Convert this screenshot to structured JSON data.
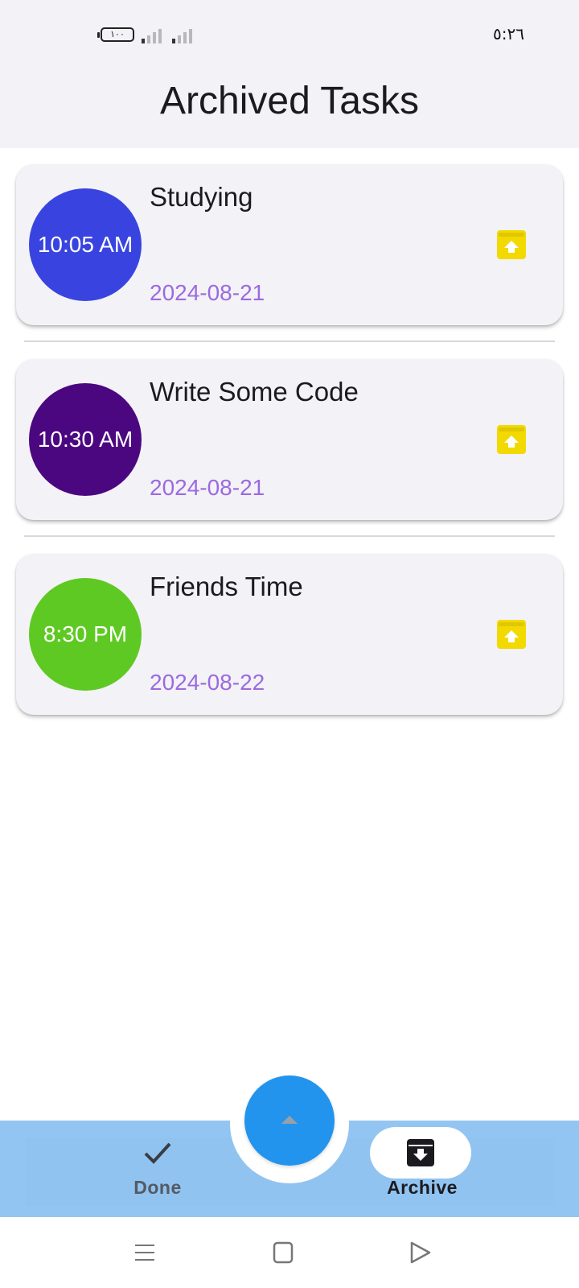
{
  "status_bar": {
    "battery_text": "١٠٠",
    "time": "٥:٢٦",
    "signal_icons": [
      "signal-bars-icon",
      "signal-bars-icon"
    ]
  },
  "header": {
    "title": "Archived Tasks"
  },
  "tasks": [
    {
      "time": "10:05 AM",
      "title": "Studying",
      "date": "2024-08-21",
      "color": "#3944e0",
      "action_icon": "unarchive-icon"
    },
    {
      "time": "10:30 AM",
      "title": "Write Some Code",
      "date": "2024-08-21",
      "color": "#4b0780",
      "action_icon": "unarchive-icon"
    },
    {
      "time": "8:30 PM",
      "title": "Friends Time",
      "date": "2024-08-22",
      "color": "#5fc924",
      "action_icon": "unarchive-icon"
    }
  ],
  "fab": {
    "icon": "caret-up-icon",
    "color": "#2394ed"
  },
  "bottom_nav": {
    "items": [
      {
        "label": "Done",
        "icon": "check-icon",
        "selected": false
      },
      {
        "label": "Archive",
        "icon": "archive-icon",
        "selected": true
      }
    ]
  },
  "system_nav": {
    "icons": [
      "menu-icon",
      "home-square-icon",
      "back-triangle-icon"
    ]
  },
  "colors": {
    "accent_yellow": "#f2d900",
    "date_purple": "#9b6ae0",
    "nav_bar": "#93c5f2"
  }
}
